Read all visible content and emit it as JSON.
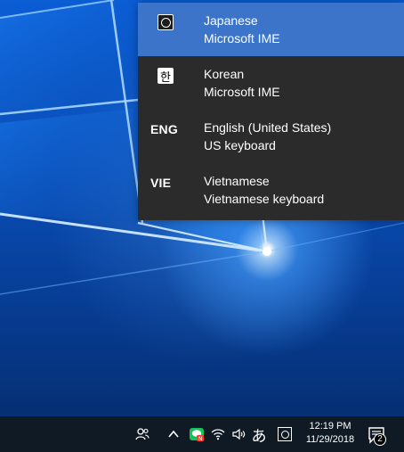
{
  "language_flyout": {
    "items": [
      {
        "line1": "Japanese",
        "line2": "Microsoft IME",
        "icon": "japanese-ime-icon",
        "selected": true
      },
      {
        "line1": "Korean",
        "line2": "Microsoft IME",
        "icon_text": "한",
        "icon": "korean-ime-icon",
        "selected": false
      },
      {
        "line1": "English (United States)",
        "line2": "US keyboard",
        "icon_text": "ENG",
        "selected": false
      },
      {
        "line1": "Vietnamese",
        "line2": "Vietnamese keyboard",
        "icon_text": "VIE",
        "selected": false
      }
    ]
  },
  "taskbar": {
    "tray_icons": [
      "people-icon",
      "chevron-up-icon",
      "line-app-icon",
      "wifi-icon",
      "volume-icon",
      "ime-hiragana-icon",
      "japanese-ime-icon"
    ],
    "ime_indicator": "あ",
    "clock": {
      "time": "12:19 PM",
      "date": "11/29/2018"
    },
    "notification_count": "2"
  },
  "colors": {
    "flyout_bg": "#2b2b2b",
    "selected_bg": "#3b74c8",
    "taskbar_bg": "#101a24",
    "desktop_blue": "#0a4fb8"
  }
}
